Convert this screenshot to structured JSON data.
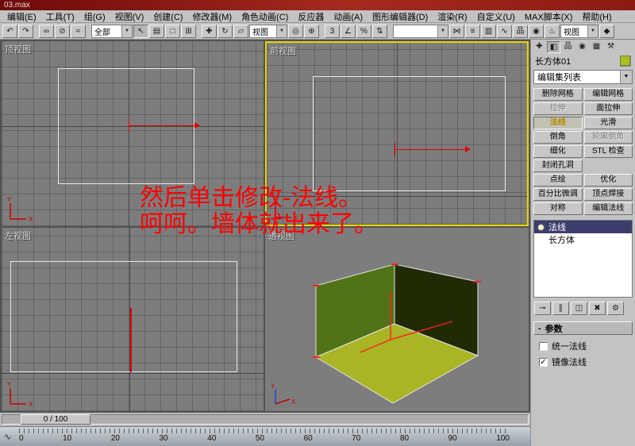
{
  "window": {
    "title": "03.max"
  },
  "menubar": {
    "items": [
      "编辑(E)",
      "工具(T)",
      "组(G)",
      "视图(V)",
      "创建(C)",
      "修改器(M)",
      "角色动画(C)",
      "反应器",
      "动画(A)",
      "图形编辑器(D)",
      "渲染(R)",
      "自定义(U)",
      "MAX脚本(X)",
      "帮助(H)"
    ]
  },
  "toolbar": {
    "filter_value": "全部",
    "coord_value": "视图",
    "named_sel_value": "",
    "render_type_value": "视图"
  },
  "icons": {
    "undo": "↶",
    "redo": "↷",
    "link": "∞",
    "unlink": "⊘",
    "bind": "≈",
    "select": "↖",
    "select_by_name": "▤",
    "region": "□",
    "crossing": "⊞",
    "move": "✚",
    "rotate": "↻",
    "scale": "▱",
    "pivot_center": "◎",
    "manipulate": "⊕",
    "snap": "3",
    "angle_snap": "∠",
    "percent_snap": "%",
    "spinner_snap": "⇅",
    "mirror": "⋈",
    "align": "≡",
    "layers": "▥",
    "curve_editor": "∿",
    "schematic": "品",
    "material_editor": "◉",
    "render": "♨",
    "quick_render": "◆",
    "dropdown_arrow": "▼",
    "tab_create": "✚",
    "tab_modify": "◧",
    "tab_hierarchy": "品",
    "tab_motion": "◉",
    "tab_display": "▦",
    "tab_utilities": "⚒",
    "pin": "⊸",
    "show_end": "∥",
    "make_unique": "◫",
    "remove_mod": "✖",
    "configure": "⚙",
    "check": "✓",
    "trackbar": "∿",
    "rollout_state": "-"
  },
  "viewports": {
    "top": {
      "label": "顶视图"
    },
    "front": {
      "label": "前视图"
    },
    "left": {
      "label": "左视图"
    },
    "persp": {
      "label": "透视图"
    }
  },
  "axis_labels": {
    "x": "X",
    "y": "Y"
  },
  "annotation": {
    "line1": "然后单击修改-法线。",
    "line2": "呵呵。墙体就出来了。"
  },
  "panel": {
    "object_name": "长方体01",
    "modifier_list_label": "编辑集列表",
    "buttons": [
      {
        "label": "删除网格"
      },
      {
        "label": "编辑网格"
      },
      {
        "label": "拉伸"
      },
      {
        "label": "面拉伸"
      },
      {
        "label": "法线"
      },
      {
        "label": "光滑"
      },
      {
        "label": "倒角"
      },
      {
        "label": "轮廓倒角"
      },
      {
        "label": "细化"
      },
      {
        "label": "STL 检查"
      },
      {
        "label": "封闭孔洞"
      },
      {
        "label": ""
      },
      {
        "label": "点绘"
      },
      {
        "label": "优化"
      },
      {
        "label": "百分比微调"
      },
      {
        "label": "顶点焊接"
      },
      {
        "label": "对称"
      },
      {
        "label": "编辑法线"
      }
    ],
    "stack": [
      {
        "label": "法线"
      },
      {
        "label": "长方体"
      }
    ],
    "rollout_title": "参数",
    "checkbox_unify": "统一法线",
    "checkbox_flip": "镜像法线"
  },
  "timeline": {
    "slider_label": "0 / 100"
  },
  "ruler": {
    "ticks": [
      "0",
      "10",
      "20",
      "30",
      "40",
      "50",
      "60",
      "70",
      "80",
      "90",
      "100"
    ]
  },
  "colors": {
    "annotation": "#ff0000",
    "active_viewport_border": "#e8d800",
    "object_color": "#a8bf1f",
    "floor": "#a9b525",
    "wall_left": "#507318",
    "wall_right": "#202b05"
  }
}
